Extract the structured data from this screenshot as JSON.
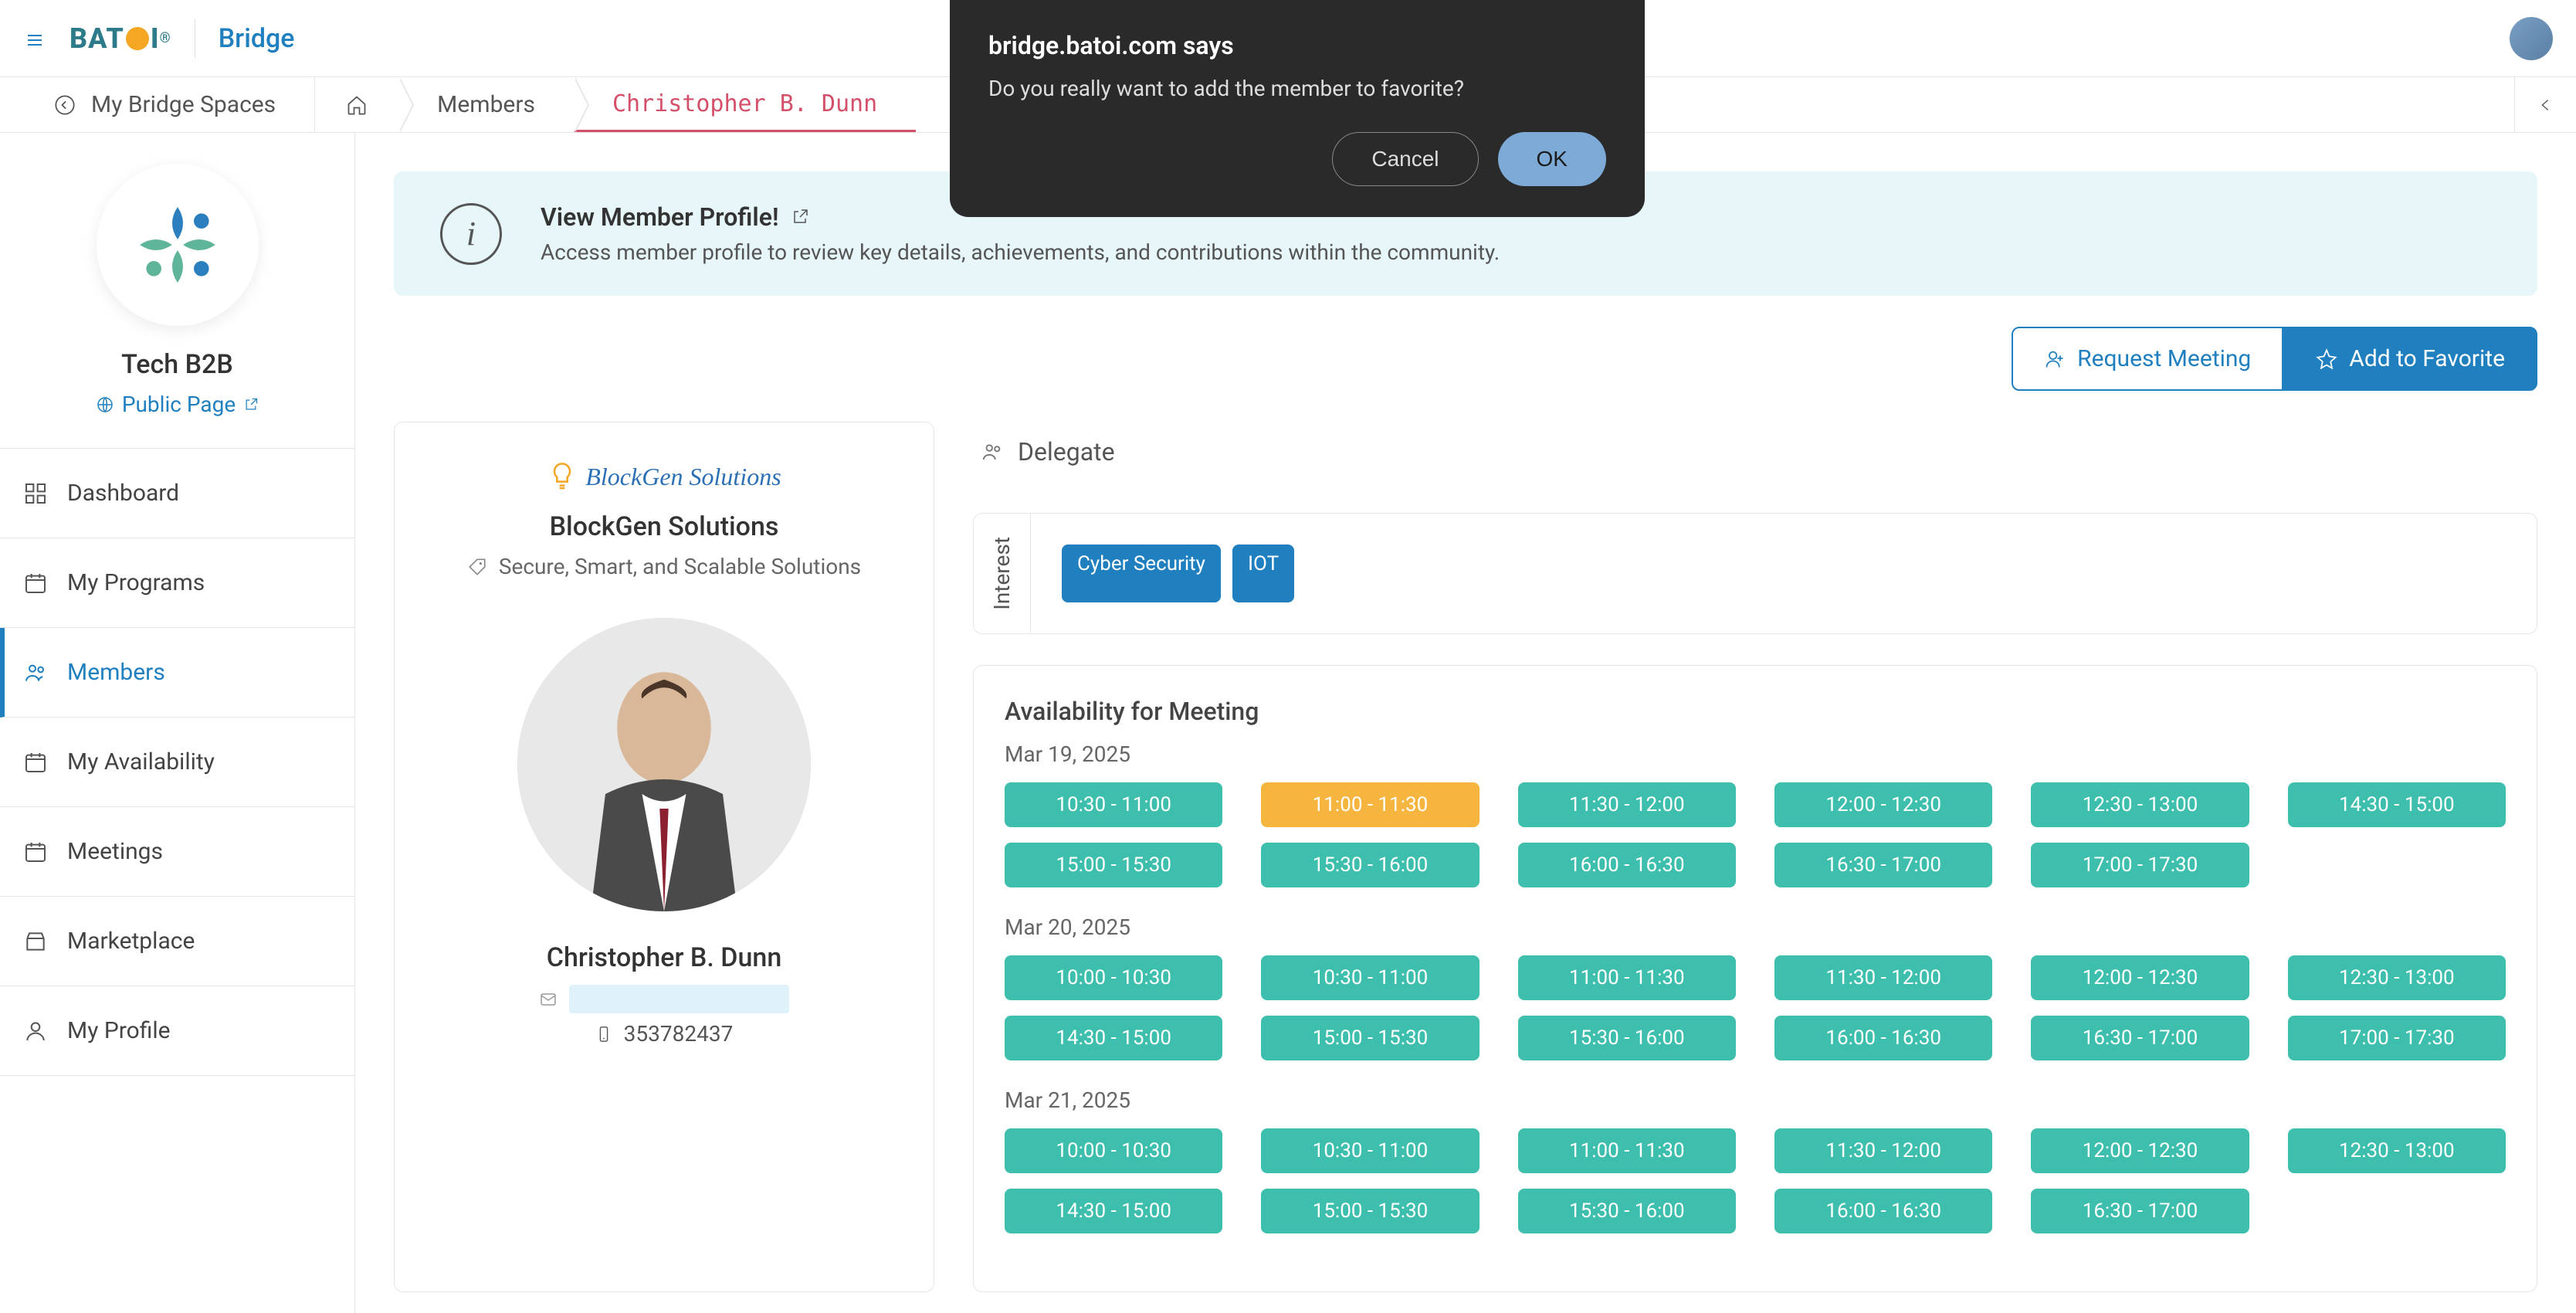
{
  "header": {
    "logo_text": "BATOI",
    "bridge_label": "Bridge"
  },
  "breadcrumb": {
    "back_label": "My Bridge Spaces",
    "members": "Members",
    "member_name": "Christopher B. Dunn"
  },
  "sidebar": {
    "org_name": "Tech B2B",
    "public_page": "Public Page",
    "items": [
      {
        "label": "Dashboard"
      },
      {
        "label": "My Programs"
      },
      {
        "label": "Members"
      },
      {
        "label": "My Availability"
      },
      {
        "label": "Meetings"
      },
      {
        "label": "Marketplace"
      },
      {
        "label": "My Profile"
      }
    ]
  },
  "info_banner": {
    "title": "View Member Profile!",
    "description": "Access member profile to review key details, achievements, and contributions within the community."
  },
  "actions": {
    "request_meeting": "Request Meeting",
    "add_favorite": "Add to Favorite"
  },
  "member_card": {
    "company_script": "BlockGen Solutions",
    "company_name": "BlockGen Solutions",
    "tagline": "Secure, Smart, and Scalable Solutions",
    "member_name": "Christopher B. Dunn",
    "email_hidden": "",
    "phone": "353782437"
  },
  "delegate_label": "Delegate",
  "interest": {
    "label": "Interest",
    "tags": [
      "Cyber Security",
      "IOT"
    ]
  },
  "availability": {
    "title": "Availability for Meeting",
    "dates": [
      {
        "label": "Mar 19, 2025",
        "slots": [
          {
            "t": "10:30 - 11:00"
          },
          {
            "t": "11:00 - 11:30",
            "warn": true
          },
          {
            "t": "11:30 - 12:00"
          },
          {
            "t": "12:00 - 12:30"
          },
          {
            "t": "12:30 - 13:00"
          },
          {
            "t": "14:30 - 15:00"
          },
          {
            "t": "15:00 - 15:30"
          },
          {
            "t": "15:30 - 16:00"
          },
          {
            "t": "16:00 - 16:30"
          },
          {
            "t": "16:30 - 17:00"
          },
          {
            "t": "17:00 - 17:30"
          }
        ]
      },
      {
        "label": "Mar 20, 2025",
        "slots": [
          {
            "t": "10:00 - 10:30"
          },
          {
            "t": "10:30 - 11:00"
          },
          {
            "t": "11:00 - 11:30"
          },
          {
            "t": "11:30 - 12:00"
          },
          {
            "t": "12:00 - 12:30"
          },
          {
            "t": "12:30 - 13:00"
          },
          {
            "t": "14:30 - 15:00"
          },
          {
            "t": "15:00 - 15:30"
          },
          {
            "t": "15:30 - 16:00"
          },
          {
            "t": "16:00 - 16:30"
          },
          {
            "t": "16:30 - 17:00"
          },
          {
            "t": "17:00 - 17:30"
          }
        ]
      },
      {
        "label": "Mar 21, 2025",
        "slots": [
          {
            "t": "10:00 - 10:30"
          },
          {
            "t": "10:30 - 11:00"
          },
          {
            "t": "11:00 - 11:30"
          },
          {
            "t": "11:30 - 12:00"
          },
          {
            "t": "12:00 - 12:30"
          },
          {
            "t": "12:30 - 13:00"
          },
          {
            "t": "14:30 - 15:00"
          },
          {
            "t": "15:00 - 15:30"
          },
          {
            "t": "15:30 - 16:00"
          },
          {
            "t": "16:00 - 16:30"
          },
          {
            "t": "16:30 - 17:00"
          }
        ]
      }
    ]
  },
  "modal": {
    "title": "bridge.batoi.com says",
    "body": "Do you really want to add the member to favorite?",
    "cancel": "Cancel",
    "ok": "OK"
  }
}
